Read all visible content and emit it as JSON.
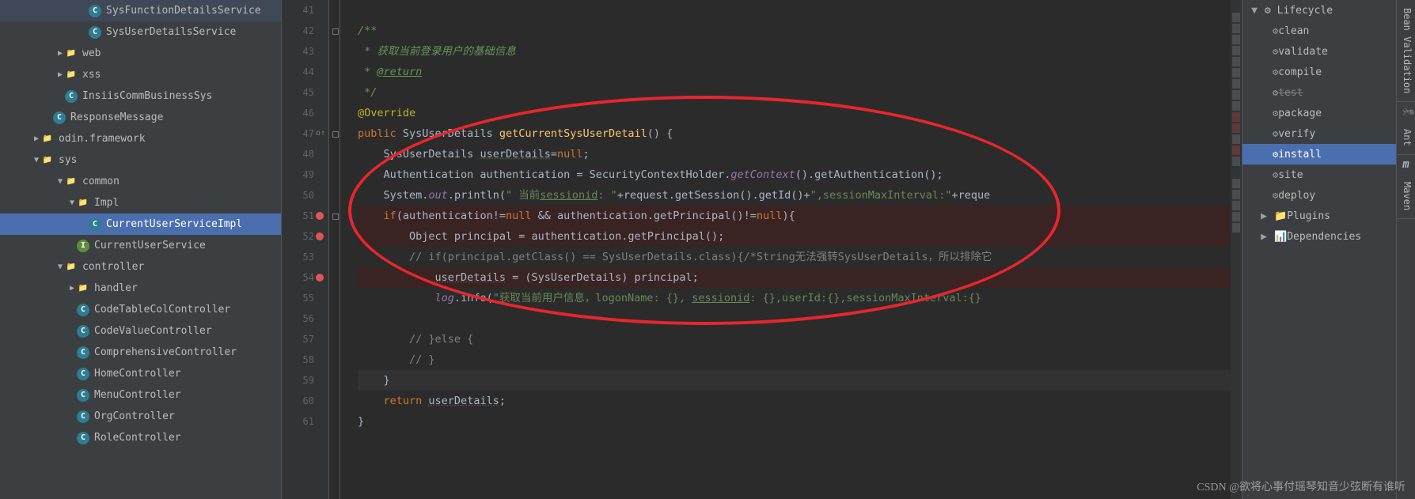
{
  "tree": [
    {
      "indent": 100,
      "arrow": "",
      "icon": "C",
      "iconClass": "icon-class",
      "label": "SysFunctionDetailsService"
    },
    {
      "indent": 100,
      "arrow": "",
      "icon": "C",
      "iconClass": "icon-class",
      "label": "SysUserDetailsService"
    },
    {
      "indent": 70,
      "arrow": "▶",
      "icon": "📁",
      "iconClass": "icon-folder",
      "label": "web"
    },
    {
      "indent": 70,
      "arrow": "▶",
      "icon": "📁",
      "iconClass": "icon-folder",
      "label": "xss"
    },
    {
      "indent": 70,
      "arrow": "",
      "icon": "C",
      "iconClass": "icon-class",
      "label": "InsiisCommBusinessSys"
    },
    {
      "indent": 55,
      "arrow": "",
      "icon": "C",
      "iconClass": "icon-class",
      "label": "ResponseMessage"
    },
    {
      "indent": 40,
      "arrow": "▶",
      "icon": "📁",
      "iconClass": "icon-folder",
      "label": "odin.framework"
    },
    {
      "indent": 40,
      "arrow": "▼",
      "icon": "📁",
      "iconClass": "icon-folder",
      "label": "sys"
    },
    {
      "indent": 70,
      "arrow": "▼",
      "icon": "📁",
      "iconClass": "icon-folder",
      "label": "common"
    },
    {
      "indent": 85,
      "arrow": "▼",
      "icon": "📁",
      "iconClass": "icon-folder",
      "label": "Impl"
    },
    {
      "indent": 100,
      "arrow": "",
      "icon": "C",
      "iconClass": "icon-class",
      "label": "CurrentUserServiceImpl",
      "selected": true
    },
    {
      "indent": 85,
      "arrow": "",
      "icon": "I",
      "iconClass": "icon-interface",
      "label": "CurrentUserService"
    },
    {
      "indent": 70,
      "arrow": "▼",
      "icon": "📁",
      "iconClass": "icon-folder",
      "label": "controller"
    },
    {
      "indent": 85,
      "arrow": "▶",
      "icon": "📁",
      "iconClass": "icon-folder",
      "label": "handler"
    },
    {
      "indent": 85,
      "arrow": "",
      "icon": "C",
      "iconClass": "icon-class",
      "label": "CodeTableColController"
    },
    {
      "indent": 85,
      "arrow": "",
      "icon": "C",
      "iconClass": "icon-class",
      "label": "CodeValueController"
    },
    {
      "indent": 85,
      "arrow": "",
      "icon": "C",
      "iconClass": "icon-class",
      "label": "ComprehensiveController"
    },
    {
      "indent": 85,
      "arrow": "",
      "icon": "C",
      "iconClass": "icon-class",
      "label": "HomeController"
    },
    {
      "indent": 85,
      "arrow": "",
      "icon": "C",
      "iconClass": "icon-class",
      "label": "MenuController"
    },
    {
      "indent": 85,
      "arrow": "",
      "icon": "C",
      "iconClass": "icon-class",
      "label": "OrgController"
    },
    {
      "indent": 85,
      "arrow": "",
      "icon": "C",
      "iconClass": "icon-class",
      "label": "RoleController"
    }
  ],
  "gutter": {
    "start": 41,
    "end": 61,
    "override_line": 47,
    "breakpoints": [
      51,
      52,
      54
    ]
  },
  "code": [
    {
      "n": 41,
      "segs": []
    },
    {
      "n": 42,
      "segs": [
        {
          "t": "/**",
          "c": "doc"
        }
      ]
    },
    {
      "n": 43,
      "segs": [
        {
          "t": " * 获取当前登录用户的基础信息",
          "c": "doc"
        }
      ]
    },
    {
      "n": 44,
      "segs": [
        {
          "t": " * ",
          "c": "doc"
        },
        {
          "t": "@return",
          "c": "doctag"
        }
      ]
    },
    {
      "n": 45,
      "segs": [
        {
          "t": " */",
          "c": "doc"
        }
      ]
    },
    {
      "n": 46,
      "segs": [
        {
          "t": "@Override",
          "c": "ann"
        }
      ]
    },
    {
      "n": 47,
      "segs": [
        {
          "t": "public ",
          "c": "kw"
        },
        {
          "t": "SysUserDetails ",
          "c": "type"
        },
        {
          "t": "getCurrentSysUserDetail",
          "c": "method"
        },
        {
          "t": "() {",
          "c": "op"
        }
      ]
    },
    {
      "n": 48,
      "indent": 1,
      "segs": [
        {
          "t": "SysUserDetails ",
          "c": "type"
        },
        {
          "t": "userDetails",
          "c": "var-u"
        },
        {
          "t": "=",
          "c": "op"
        },
        {
          "t": "null",
          "c": "kw"
        },
        {
          "t": ";",
          "c": "op"
        }
      ]
    },
    {
      "n": 49,
      "indent": 1,
      "segs": [
        {
          "t": "Authentication authentication = SecurityContextHolder.",
          "c": "type"
        },
        {
          "t": "getContext",
          "c": "field"
        },
        {
          "t": "().getAuthentication();",
          "c": "type"
        }
      ]
    },
    {
      "n": 50,
      "indent": 1,
      "segs": [
        {
          "t": "System.",
          "c": "type"
        },
        {
          "t": "out",
          "c": "field"
        },
        {
          "t": ".println(",
          "c": "type"
        },
        {
          "t": "\" 当前",
          "c": "str"
        },
        {
          "t": "sessionid",
          "c": "str",
          "u": true
        },
        {
          "t": ": \"",
          "c": "str"
        },
        {
          "t": "+request.getSession().getId()+",
          "c": "type"
        },
        {
          "t": "\",sessionMaxInterval:\"",
          "c": "str"
        },
        {
          "t": "+reque",
          "c": "type"
        }
      ]
    },
    {
      "n": 51,
      "hl": true,
      "indent": 1,
      "segs": [
        {
          "t": "if",
          "c": "kw"
        },
        {
          "t": "(authentication!=",
          "c": "type"
        },
        {
          "t": "null ",
          "c": "kw"
        },
        {
          "t": "&& authentication.getPrincipal()!=",
          "c": "type"
        },
        {
          "t": "null",
          "c": "kw"
        },
        {
          "t": ")",
          "c": "type"
        },
        {
          "t": "{",
          "c": "op"
        }
      ]
    },
    {
      "n": 52,
      "hl": true,
      "indent": 2,
      "segs": [
        {
          "t": "Object principal = authentication.getPrincipal();",
          "c": "type"
        }
      ]
    },
    {
      "n": 53,
      "indent": 2,
      "segs": [
        {
          "t": "// if(principal.getClass() == SysUserDetails.class){/*String无法强转SysUserDetails，所以排除它",
          "c": "cmt"
        }
      ]
    },
    {
      "n": 54,
      "hl": true,
      "indent": 3,
      "segs": [
        {
          "t": "userDetails",
          "c": "var-u"
        },
        {
          "t": " = (SysUserDetails) principal;",
          "c": "type"
        }
      ]
    },
    {
      "n": 55,
      "indent": 3,
      "segs": [
        {
          "t": "log",
          "c": "field"
        },
        {
          "t": ".info(",
          "c": "type"
        },
        {
          "t": "\"获取当前用户信息，logonName: {}, ",
          "c": "str"
        },
        {
          "t": "sessionid",
          "c": "str",
          "u": true
        },
        {
          "t": ": {},userId:{},sessionMaxInterval:{}",
          "c": "str"
        }
      ]
    },
    {
      "n": 56,
      "segs": []
    },
    {
      "n": 57,
      "indent": 2,
      "segs": [
        {
          "t": "// }else {",
          "c": "cmt"
        }
      ]
    },
    {
      "n": 58,
      "indent": 2,
      "segs": [
        {
          "t": "// }",
          "c": "cmt"
        }
      ]
    },
    {
      "n": 59,
      "cursor": true,
      "indent": 1,
      "segs": [
        {
          "t": "}",
          "c": "op"
        }
      ]
    },
    {
      "n": 60,
      "indent": 1,
      "segs": [
        {
          "t": "return ",
          "c": "kw"
        },
        {
          "t": "userDetails",
          "c": "var-u"
        },
        {
          "t": ";",
          "c": "op"
        }
      ]
    },
    {
      "n": 61,
      "segs": [
        {
          "t": "}",
          "c": "op"
        }
      ]
    }
  ],
  "maven": {
    "header": "Lifecycle",
    "items": [
      {
        "label": "clean"
      },
      {
        "label": "validate"
      },
      {
        "label": "compile"
      },
      {
        "label": "test",
        "strike": true
      },
      {
        "label": "package"
      },
      {
        "label": "verify"
      },
      {
        "label": "install",
        "selected": true
      },
      {
        "label": "site"
      },
      {
        "label": "deploy"
      }
    ],
    "footer": [
      {
        "arrow": "▶",
        "icon": "📁",
        "label": "Plugins"
      },
      {
        "arrow": "▶",
        "icon": "📊",
        "label": "Dependencies"
      }
    ]
  },
  "sideTabs": [
    "Bean Validation",
    "Ant",
    "Maven"
  ],
  "watermark": "CSDN @欲将心事付瑶琴知音少弦断有谁听"
}
